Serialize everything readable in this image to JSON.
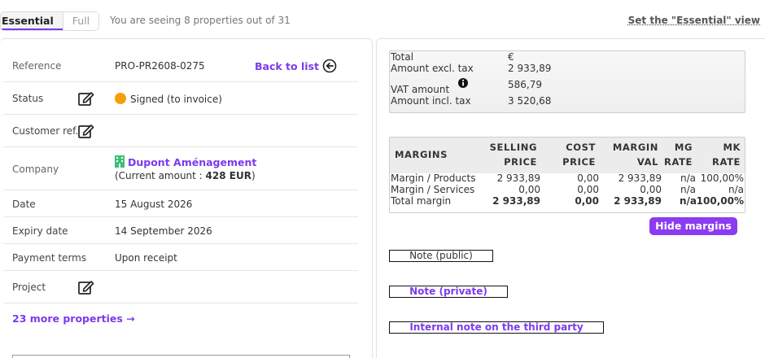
{
  "tabs": {
    "essential": "Essential",
    "full": "Full"
  },
  "info_text": "You are seeing 8 properties out of 31",
  "set_essential_link": "Set the \"Essential\" view",
  "fields": {
    "reference": {
      "label": "Reference",
      "value": "PRO-PR2608-0275",
      "back_link": "Back to list"
    },
    "status": {
      "label": "Status",
      "value": "Signed (to invoice)",
      "dot_color": "#f59e0b"
    },
    "customer_ref": {
      "label": "Customer ref."
    },
    "company": {
      "label": "Company",
      "name": "Dupont Aménagement",
      "current_prefix": "(Current amount : ",
      "current_amount": "428 EUR",
      "current_suffix": ")"
    },
    "date": {
      "label": "Date",
      "value": "15 August 2026"
    },
    "expiry": {
      "label": "Expiry date",
      "value": "14 September 2026"
    },
    "payment_terms": {
      "label": "Payment terms",
      "value": "Upon receipt"
    },
    "project": {
      "label": "Project"
    }
  },
  "more_link": "23 more properties →",
  "totals": {
    "total_label": "Total",
    "currency": "€",
    "excl_label": "Amount excl. tax",
    "excl_value": "2 933,89",
    "vat_label": "VAT amount",
    "vat_value": "586,79",
    "incl_label": "Amount incl. tax",
    "incl_value": "3 520,68"
  },
  "margins": {
    "header": {
      "title": "MARGINS",
      "selling_1": "SELLING",
      "selling_2": "PRICE",
      "cost_1": "COST",
      "cost_2": "PRICE",
      "margin_1": "MARGIN",
      "margin_2": "VAL",
      "mg_1": "MG",
      "mg_2": "RATE",
      "mk_1": "MK",
      "mk_2": "RATE"
    },
    "rows": [
      {
        "label": "Margin / Products",
        "selling": "2 933,89",
        "cost": "0,00",
        "margin": "2 933,89",
        "mg": "n/a",
        "mk": "100,00%"
      },
      {
        "label": "Margin / Services",
        "selling": "0,00",
        "cost": "0,00",
        "margin": "0,00",
        "mg": "n/a",
        "mk": "n/a"
      },
      {
        "label": "Total margin",
        "selling": "2 933,89",
        "cost": "0,00",
        "margin": "2 933,89",
        "mg": "n/a",
        "mk": "100,00%"
      }
    ]
  },
  "hide_margins": "Hide margins",
  "notes": {
    "public": "Note (public)",
    "private": "Note (private)",
    "third_party": "Internal note on the third party"
  },
  "colors": {
    "accent": "#7c3aed",
    "button": "#8b3cf0",
    "status": "#f59e0b"
  },
  "icons": [
    "edit-icon",
    "back-arrow-circle-icon",
    "building-icon",
    "info-icon"
  ]
}
